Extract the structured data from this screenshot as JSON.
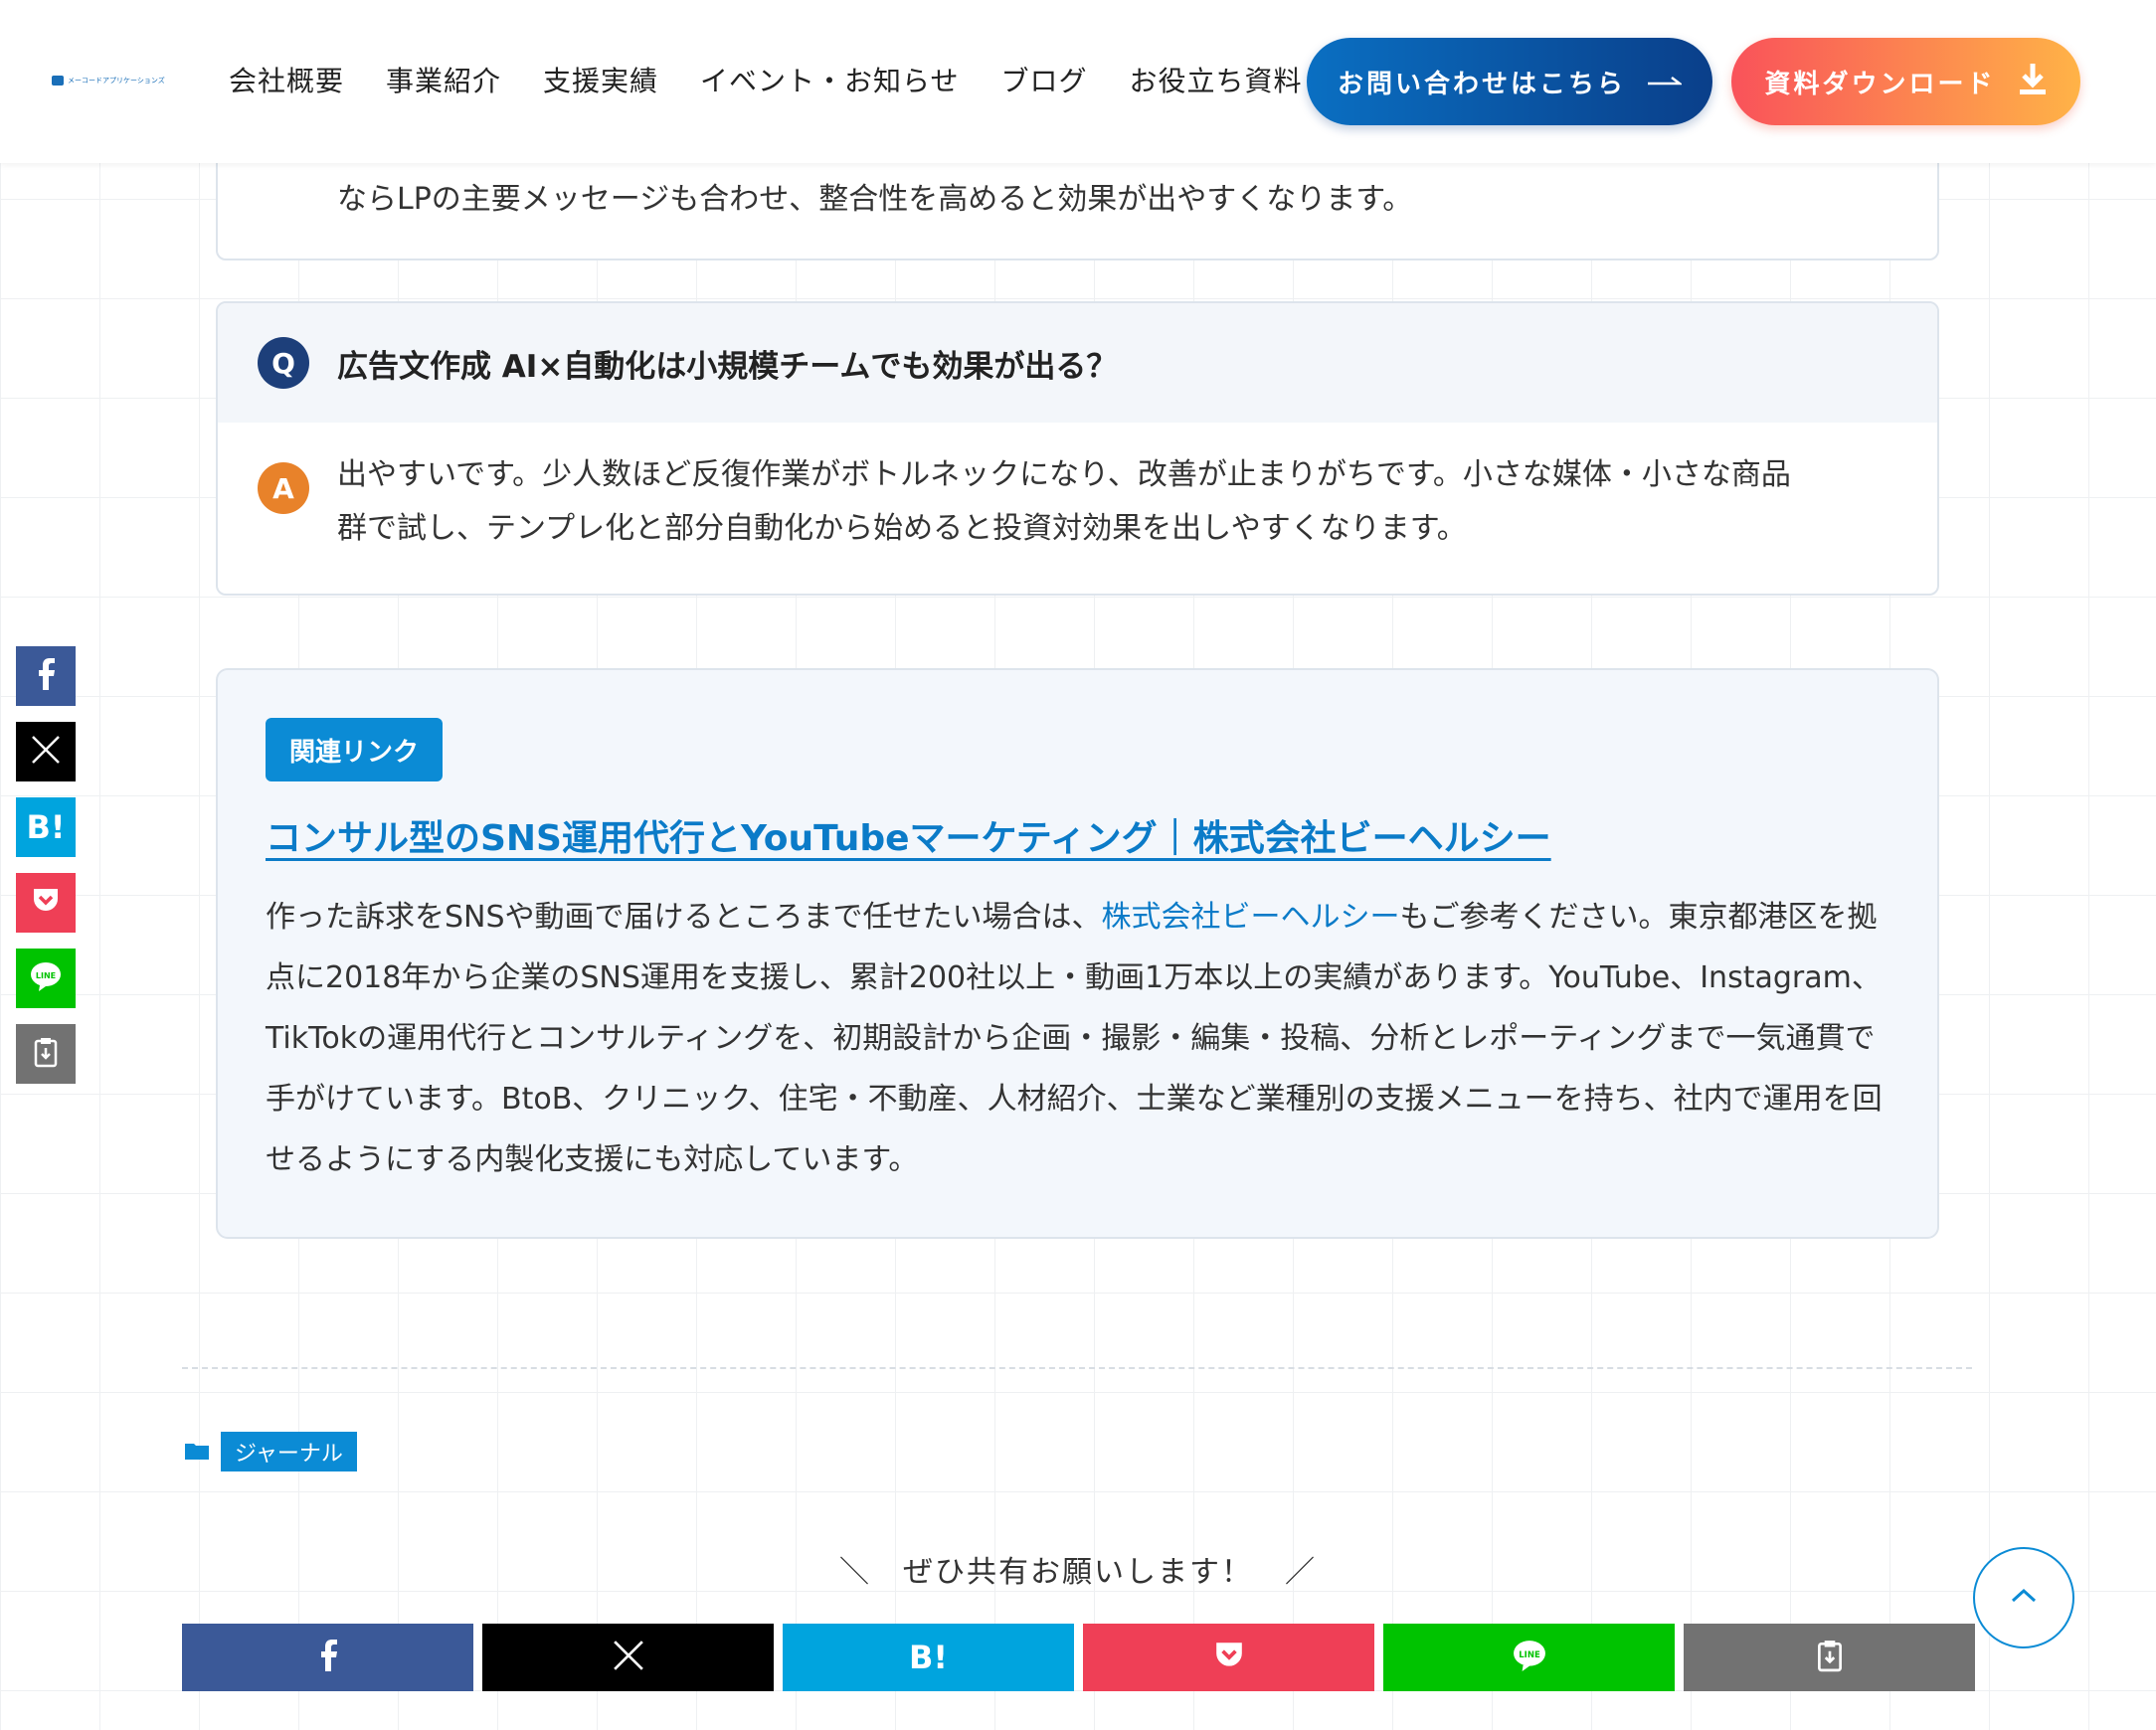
{
  "header": {
    "logo_text": "メーコードアプリケーションズ",
    "nav": [
      "会社概要",
      "事業紹介",
      "支援実績",
      "イベント・お知らせ",
      "ブログ",
      "お役立ち資料"
    ],
    "contact_button": "お問い合わせはこちら",
    "download_button": "資料ダウンロード"
  },
  "faq": [
    {
      "answer_letter": "A",
      "answer": "ならLPの主要メッセージも合わせ、整合性を高めると効果が出やすくなります。"
    },
    {
      "question_letter": "Q",
      "question": "広告文作成 AI×自動化は小規模チームでも効果が出る？",
      "answer_letter": "A",
      "answer_line1": "出やすいです。少人数ほど反復作業がボトルネックになり、改善が止まりがちです。小さな媒体・小さな商品",
      "answer_line2": "群で試し、テンプレ化と部分自動化から始めると投資対効果を出しやすくなります。"
    }
  ],
  "related": {
    "badge": "関連リンク",
    "title": "コンサル型のSNS運用代行とYouTubeマーケティング｜株式会社ビーヘルシー",
    "body_pre": "作った訴求をSNSや動画で届けるところまで任せたい場合は、",
    "body_link": "株式会社ビーヘルシー",
    "body_post": "もご参考ください。東京都港区を拠点に2018年から企業のSNS運用を支援し、累計200社以上・動画1万本以上の実績があります。YouTube、Instagram、TikTokの運用代行とコンサルティングを、初期設計から企画・撮影・編集・投稿、分析とレポーティングまで一気通貫で手がけています。BtoB、クリニック、住宅・不動産、人材紹介、士業など業種別の支援メニューを持ち、社内で運用を回せるようにする内製化支援にも対応しています。"
  },
  "category": "ジャーナル",
  "share": {
    "heading": "＼　ぜひ共有お願いします！　／",
    "hatena_label": "B!"
  },
  "icons": {
    "facebook": "facebook-icon",
    "x": "x-icon",
    "hatena": "hatena-icon",
    "pocket": "pocket-icon",
    "line": "line-icon",
    "copy": "copy-icon"
  },
  "colors": {
    "facebook": "#3b5998",
    "x": "#000000",
    "hatena": "#00a4de",
    "pocket": "#ef3f56",
    "line": "#00c300",
    "copy": "#727272",
    "accent": "#0b8bd5"
  }
}
